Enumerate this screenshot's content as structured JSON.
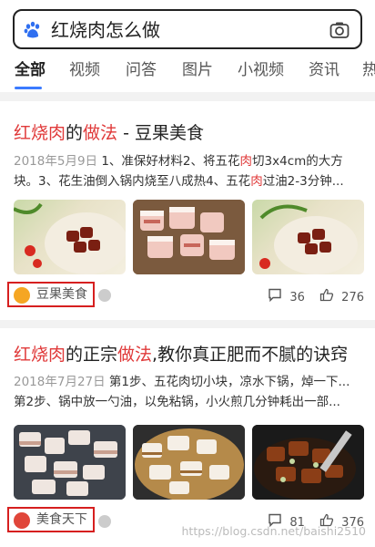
{
  "search": {
    "query": "红烧肉怎么做"
  },
  "tabs": [
    "全部",
    "视频",
    "问答",
    "图片",
    "小视频",
    "资讯",
    "热"
  ],
  "results": [
    {
      "title_parts": [
        "红烧肉",
        "的",
        "做法",
        " - 豆果美食"
      ],
      "date": "2018年5月9日",
      "snippet_line1_a": " 1、准保好材料2、将五花",
      "snippet_hl_1": "肉",
      "snippet_line1_b": "切3x4cm的大方",
      "snippet_line2_a": "块。3、花生油倒入锅内烧至八成热4、五花",
      "snippet_hl_2": "肉",
      "snippet_line2_b": "过油2-3分钟...",
      "source": "豆果美食",
      "comments": "36",
      "likes": "276"
    },
    {
      "title_parts": [
        "红烧肉",
        "的正宗",
        "做法",
        ",教你真正肥而不腻的诀窍"
      ],
      "date": "2018年7月27日",
      "snippet_line1": " 第1步、五花肉切小块，凉水下锅，焯一下...",
      "snippet_line2": "第2步、锅中放一勺油，以免粘锅，小火煎几分钟耗出一部...",
      "source": "美食天下",
      "comments": "81",
      "likes": "376"
    }
  ],
  "watermark": "https://blog.csdn.net/baishi2510",
  "colors": {
    "accent": "#3b7bff",
    "highlight": "#e03a3a",
    "source_box": "#d61f1f"
  }
}
